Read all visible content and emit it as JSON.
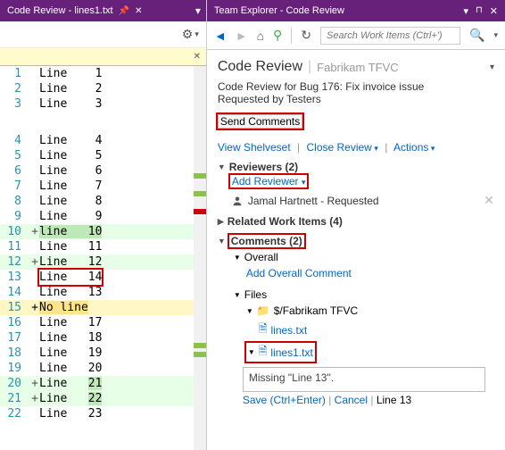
{
  "left": {
    "tab_label": "Code Review - lines1.txt",
    "gear": "⚙",
    "infobar_close": "✕",
    "lines": [
      {
        "n": 1,
        "t": "Line    1"
      },
      {
        "n": 2,
        "t": "Line    2"
      },
      {
        "n": 3,
        "t": "Line    3"
      },
      {
        "gap": true
      },
      {
        "n": 4,
        "t": "Line    4"
      },
      {
        "n": 5,
        "t": "Line    5"
      },
      {
        "n": 6,
        "t": "Line    6"
      },
      {
        "n": 7,
        "t": "Line    7"
      },
      {
        "n": 8,
        "t": "Line    8"
      },
      {
        "n": 9,
        "t": "Line    9"
      },
      {
        "n": 10,
        "t": "line   10",
        "add": true,
        "hl": "1",
        "p": "+"
      },
      {
        "n": 11,
        "t": "Line   11"
      },
      {
        "n": 12,
        "t": "Line   12",
        "add": true,
        "p": "+"
      },
      {
        "n": 13,
        "t": "Line   14",
        "sel": true
      },
      {
        "n": 14,
        "t": "Line   13"
      },
      {
        "n": 15,
        "t": "No line",
        "nl": true,
        "hl": "2",
        "p": "+"
      },
      {
        "n": 16,
        "t": "Line   17"
      },
      {
        "n": 17,
        "t": "Line   18"
      },
      {
        "n": 18,
        "t": "Line   19"
      },
      {
        "n": 19,
        "t": "Line   20"
      },
      {
        "n": 20,
        "t": "Line   21",
        "add": true,
        "p": "+",
        "hl": "1",
        "hw": 2
      },
      {
        "n": 21,
        "t": "Line   22",
        "add": true,
        "p": "+",
        "hl": "1",
        "hw": 2
      },
      {
        "n": 22,
        "t": "Line   23"
      }
    ]
  },
  "right": {
    "title": "Team Explorer - Code Review",
    "search_placeholder": "Search Work Items (Ctrl+')",
    "h1": "Code Review",
    "h1_sub": "Fabrikam TFVC",
    "desc": "Code Review for Bug 176: Fix invoice issue",
    "req": "Requested by Testers",
    "send_btn": "Send Comments",
    "link_shelveset": "View Shelveset",
    "link_close": "Close Review",
    "link_actions": "Actions",
    "reviewers_head": "Reviewers (2)",
    "add_reviewer": "Add Reviewer",
    "reviewer_name": "Jamal Hartnett - Requested",
    "related_head": "Related Work Items (4)",
    "comments_head": "Comments (2)",
    "overall": "Overall",
    "add_overall": "Add Overall Comment",
    "files": "Files",
    "folder": "$/Fabrikam TFVC",
    "file1": "lines.txt",
    "file2": "lines1.txt",
    "comment_text": "Missing \"Line 13\".",
    "save": "Save (Ctrl+Enter)",
    "cancel": "Cancel",
    "status": "Line 13"
  }
}
